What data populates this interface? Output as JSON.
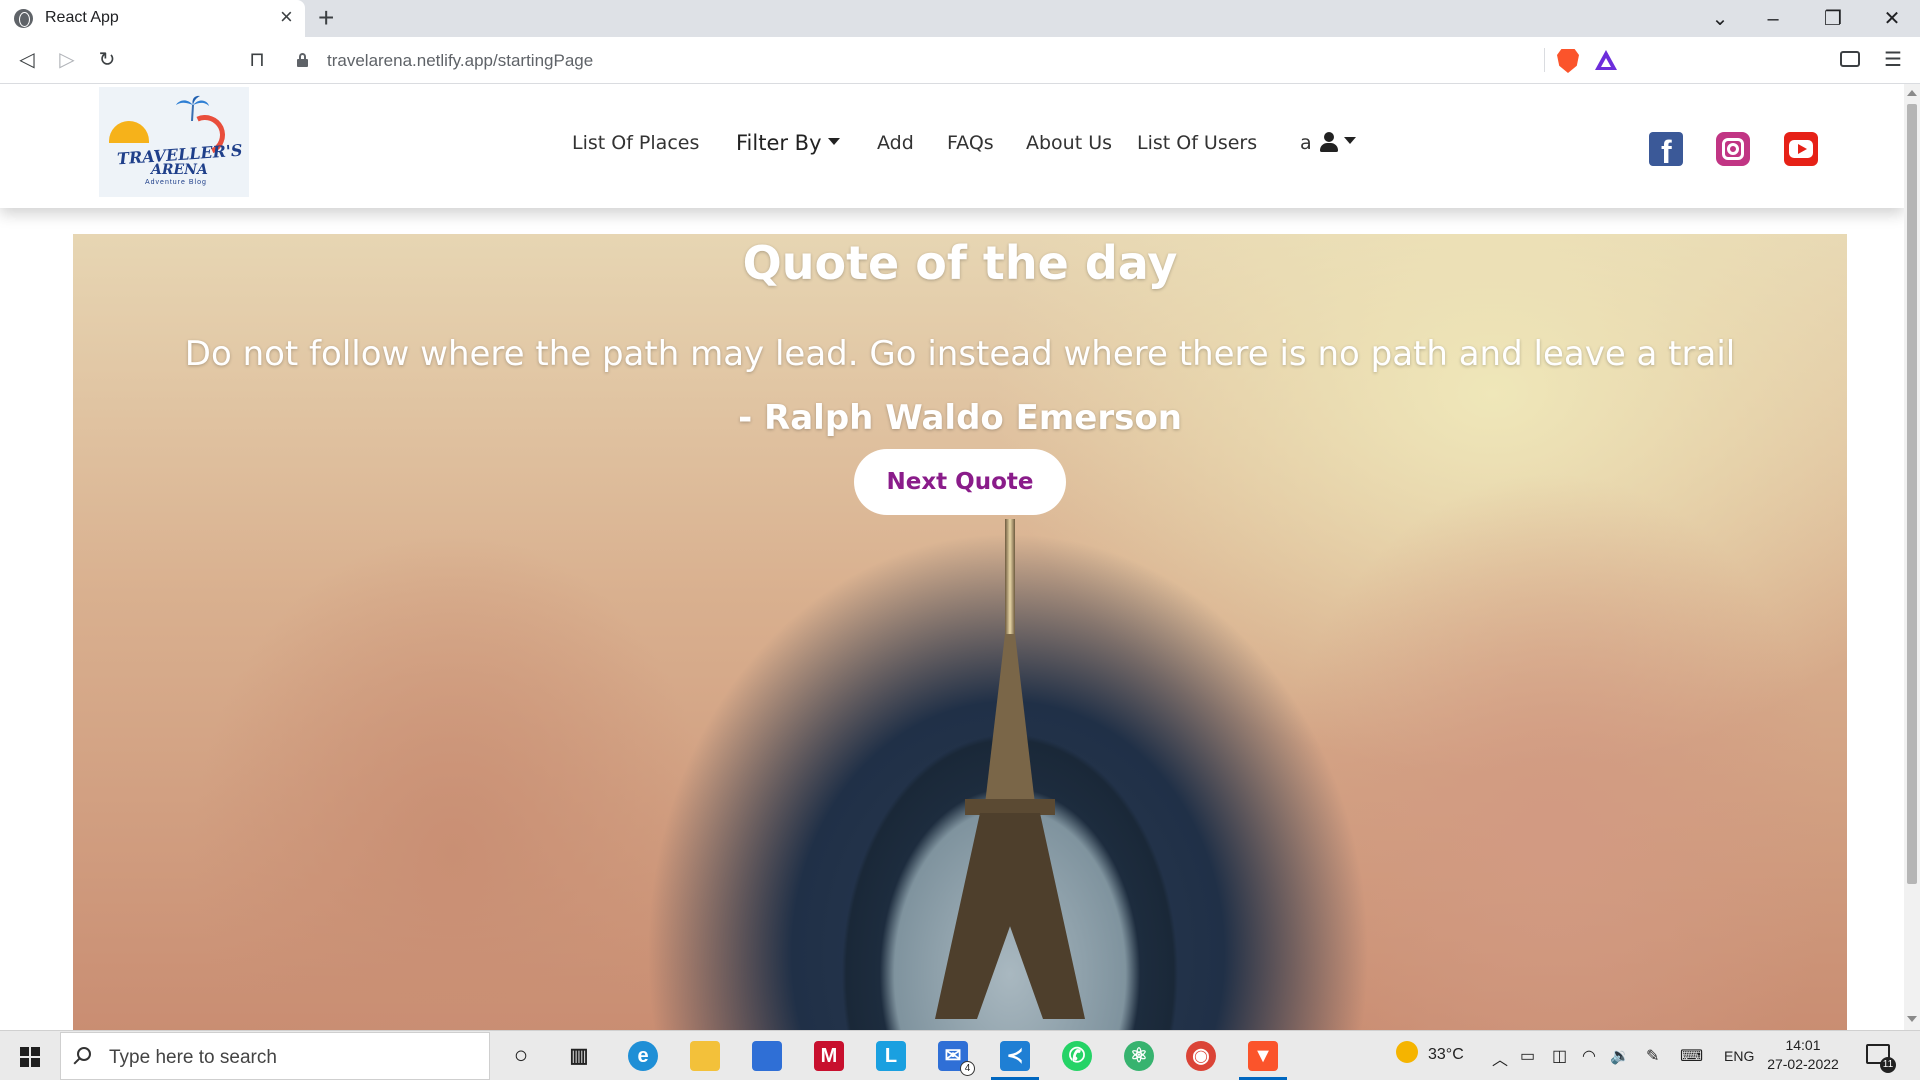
{
  "browser": {
    "tab_title": "React App",
    "url": "travelarena.netlify.app/startingPage"
  },
  "site": {
    "logo_text_line1": "TRAVELLER'S",
    "logo_text_line2": "ARENA",
    "logo_tagline": "Adventure Blog",
    "nav": {
      "list_of_places": "List Of Places",
      "filter_by": "Filter By",
      "add": "Add",
      "faqs": "FAQs",
      "about_us": "About Us",
      "list_of_users": "List Of Users",
      "user_initial": "a"
    },
    "social_icons": [
      "facebook-icon",
      "instagram-icon",
      "youtube-icon"
    ]
  },
  "hero": {
    "title": "Quote of the day",
    "quote": "Do not follow where the path may lead. Go instead where there is no path and leave a trail",
    "author": "- Ralph Waldo Emerson",
    "button_label": "Next Quote"
  },
  "colors": {
    "button_text": "#8a1c8a",
    "facebook": "#3b5998",
    "instagram": "#c13584",
    "youtube": "#e62117"
  },
  "taskbar": {
    "search_placeholder": "Type here to search",
    "mail_badge": "4",
    "temperature": "33°C",
    "language": "ENG",
    "time": "14:01",
    "date": "27-02-2022",
    "notification_count": "11"
  }
}
